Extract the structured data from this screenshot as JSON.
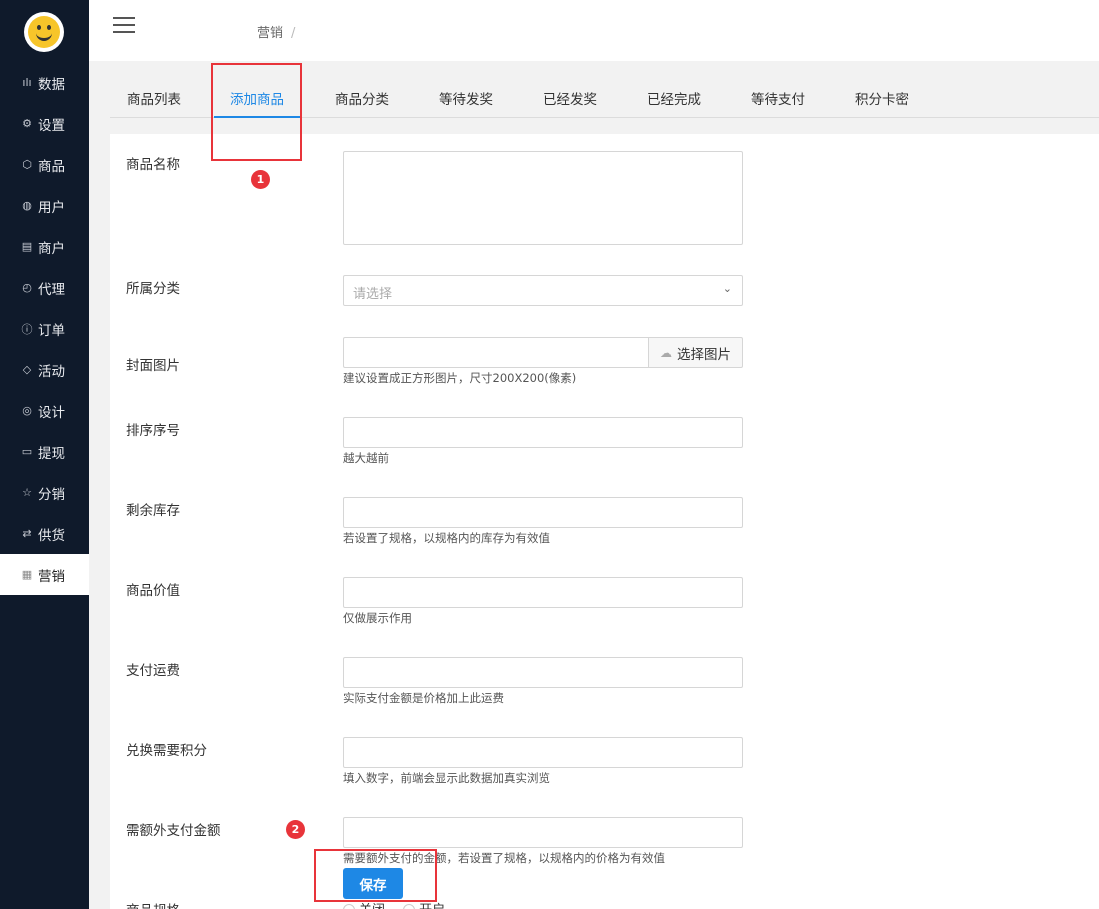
{
  "sidebar": {
    "items": [
      {
        "icon": "bar-chart-icon",
        "glyph": "ılı",
        "label": "数据"
      },
      {
        "icon": "gear-icon",
        "glyph": "⚙",
        "label": "设置"
      },
      {
        "icon": "box-icon",
        "glyph": "⬡",
        "label": "商品"
      },
      {
        "icon": "user-icon",
        "glyph": "◍",
        "label": "用户"
      },
      {
        "icon": "list-icon",
        "glyph": "▤",
        "label": "商户"
      },
      {
        "icon": "clock-icon",
        "glyph": "◴",
        "label": "代理"
      },
      {
        "icon": "info-icon",
        "glyph": "ⓘ",
        "label": "订单"
      },
      {
        "icon": "tag-icon",
        "glyph": "◇",
        "label": "活动"
      },
      {
        "icon": "palette-icon",
        "glyph": "◎",
        "label": "设计"
      },
      {
        "icon": "card-icon",
        "glyph": "▭",
        "label": "提现"
      },
      {
        "icon": "star-icon",
        "glyph": "☆",
        "label": "分销"
      },
      {
        "icon": "swap-icon",
        "glyph": "⇄",
        "label": "供货"
      },
      {
        "icon": "grid-icon",
        "glyph": "▦",
        "label": "营销"
      }
    ],
    "active_index": 12
  },
  "header": {
    "breadcrumb": "营销",
    "breadcrumb_sep": "/"
  },
  "tabs": [
    {
      "label": "商品列表"
    },
    {
      "label": "添加商品"
    },
    {
      "label": "商品分类"
    },
    {
      "label": "等待发奖"
    },
    {
      "label": "已经发奖"
    },
    {
      "label": "已经完成"
    },
    {
      "label": "等待支付"
    },
    {
      "label": "积分卡密"
    }
  ],
  "form": {
    "name": {
      "label": "商品名称",
      "value": ""
    },
    "category": {
      "label": "所属分类",
      "placeholder": "请选择"
    },
    "cover": {
      "label": "封面图片",
      "value": "",
      "button": "选择图片",
      "hint": "建议设置成正方形图片，尺寸200X200(像素)"
    },
    "sort": {
      "label": "排序序号",
      "value": "",
      "hint": "越大越前"
    },
    "stock": {
      "label": "剩余库存",
      "value": "",
      "hint": "若设置了规格，以规格内的库存为有效值"
    },
    "price": {
      "label": "商品价值",
      "value": "",
      "hint": "仅做展示作用"
    },
    "shipping": {
      "label": "支付运费",
      "value": "",
      "hint": "实际支付金额是价格加上此运费"
    },
    "points": {
      "label": "兑换需要积分",
      "value": "",
      "hint": "填入数字，前端会显示此数据加真实浏览"
    },
    "extra": {
      "label": "需额外支付金额",
      "value": "",
      "hint": "需要额外支付的金额，若设置了规格，以规格内的价格为有效值"
    },
    "spec": {
      "label": "商品规格",
      "opt_off": "关闭",
      "opt_on": "开启"
    },
    "save": "保存"
  },
  "annotations": [
    "1",
    "2"
  ],
  "colors": {
    "accent": "#1e88e5",
    "sidebar": "#0f1a2b",
    "annotation": "#e8343a"
  }
}
